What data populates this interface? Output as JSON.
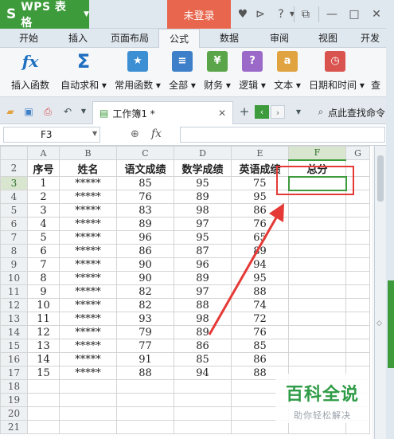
{
  "titlebar": {
    "app_name": "WPS 表格",
    "login_label": "未登录",
    "help_label": "?"
  },
  "menu_tabs": [
    {
      "label": "开始"
    },
    {
      "label": "插入"
    },
    {
      "label": "页面布局"
    },
    {
      "label": "公式",
      "active": true
    },
    {
      "label": "数据"
    },
    {
      "label": "审阅"
    },
    {
      "label": "视图"
    },
    {
      "label": "开发"
    }
  ],
  "ribbon": [
    {
      "label": "插入函数",
      "icon": "fx-icon",
      "glyph": "fx",
      "color": "#1e6fc0"
    },
    {
      "label": "自动求和",
      "icon": "sum-icon",
      "glyph": "Σ",
      "color": "#1e6fc0"
    },
    {
      "label": "常用函数",
      "icon": "star-function-icon",
      "glyph": "★",
      "color": "#3d8fd4"
    },
    {
      "label": "全部",
      "icon": "all-functions-icon",
      "glyph": "≡",
      "color": "#3d7fc8"
    },
    {
      "label": "财务",
      "icon": "finance-icon",
      "glyph": "¥",
      "color": "#5aa54a"
    },
    {
      "label": "逻辑",
      "icon": "logic-icon",
      "glyph": "?",
      "color": "#9b6ac8"
    },
    {
      "label": "文本",
      "icon": "text-icon",
      "glyph": "a",
      "color": "#e0a340"
    },
    {
      "label": "日期和时间",
      "icon": "datetime-icon",
      "glyph": "◷",
      "color": "#d9534f"
    },
    {
      "label": "查",
      "icon": "lookup-icon",
      "glyph": "",
      "color": "#7a8590"
    }
  ],
  "docbar": {
    "doc_name": "工作簿1 *",
    "search_label": "点此查找命令"
  },
  "formula_bar": {
    "cell_ref": "F3",
    "fx_label": "fx"
  },
  "sheet": {
    "columns": [
      "A",
      "B",
      "C",
      "D",
      "E",
      "F",
      "G"
    ],
    "header_row": [
      "序号",
      "姓名",
      "语文成绩",
      "数学成绩",
      "英语成绩",
      "总分"
    ],
    "rows": [
      {
        "n": "3",
        "cells": [
          "1",
          "*****",
          "85",
          "95",
          "75",
          ""
        ]
      },
      {
        "n": "4",
        "cells": [
          "2",
          "*****",
          "76",
          "89",
          "95",
          ""
        ]
      },
      {
        "n": "5",
        "cells": [
          "3",
          "*****",
          "83",
          "98",
          "86",
          ""
        ]
      },
      {
        "n": "6",
        "cells": [
          "4",
          "*****",
          "89",
          "97",
          "76",
          ""
        ]
      },
      {
        "n": "7",
        "cells": [
          "5",
          "*****",
          "96",
          "95",
          "65",
          ""
        ]
      },
      {
        "n": "8",
        "cells": [
          "6",
          "*****",
          "86",
          "87",
          "89",
          ""
        ]
      },
      {
        "n": "9",
        "cells": [
          "7",
          "*****",
          "90",
          "96",
          "94",
          ""
        ]
      },
      {
        "n": "10",
        "cells": [
          "8",
          "*****",
          "90",
          "89",
          "95",
          ""
        ]
      },
      {
        "n": "11",
        "cells": [
          "9",
          "*****",
          "82",
          "97",
          "88",
          ""
        ]
      },
      {
        "n": "12",
        "cells": [
          "10",
          "*****",
          "82",
          "88",
          "74",
          ""
        ]
      },
      {
        "n": "13",
        "cells": [
          "11",
          "*****",
          "93",
          "98",
          "72",
          ""
        ]
      },
      {
        "n": "14",
        "cells": [
          "12",
          "*****",
          "79",
          "89",
          "76",
          ""
        ]
      },
      {
        "n": "15",
        "cells": [
          "13",
          "*****",
          "77",
          "86",
          "85",
          ""
        ]
      },
      {
        "n": "16",
        "cells": [
          "14",
          "*****",
          "91",
          "85",
          "86",
          ""
        ]
      },
      {
        "n": "17",
        "cells": [
          "15",
          "*****",
          "88",
          "94",
          "88",
          ""
        ]
      },
      {
        "n": "18",
        "cells": [
          "",
          "",
          "",
          "",
          "",
          ""
        ]
      },
      {
        "n": "19",
        "cells": [
          "",
          "",
          "",
          "",
          "",
          ""
        ]
      },
      {
        "n": "20",
        "cells": [
          "",
          "",
          "",
          "",
          "",
          ""
        ]
      },
      {
        "n": "21",
        "cells": [
          "",
          "",
          "",
          "",
          "",
          ""
        ]
      }
    ],
    "selected_cell": "F3"
  },
  "watermark": {
    "title": "百科全说",
    "subtitle": "助你轻松解决"
  },
  "colors": {
    "accent_green": "#3e9b3c",
    "login_orange": "#e8664d",
    "annotation_red": "#e53935"
  }
}
